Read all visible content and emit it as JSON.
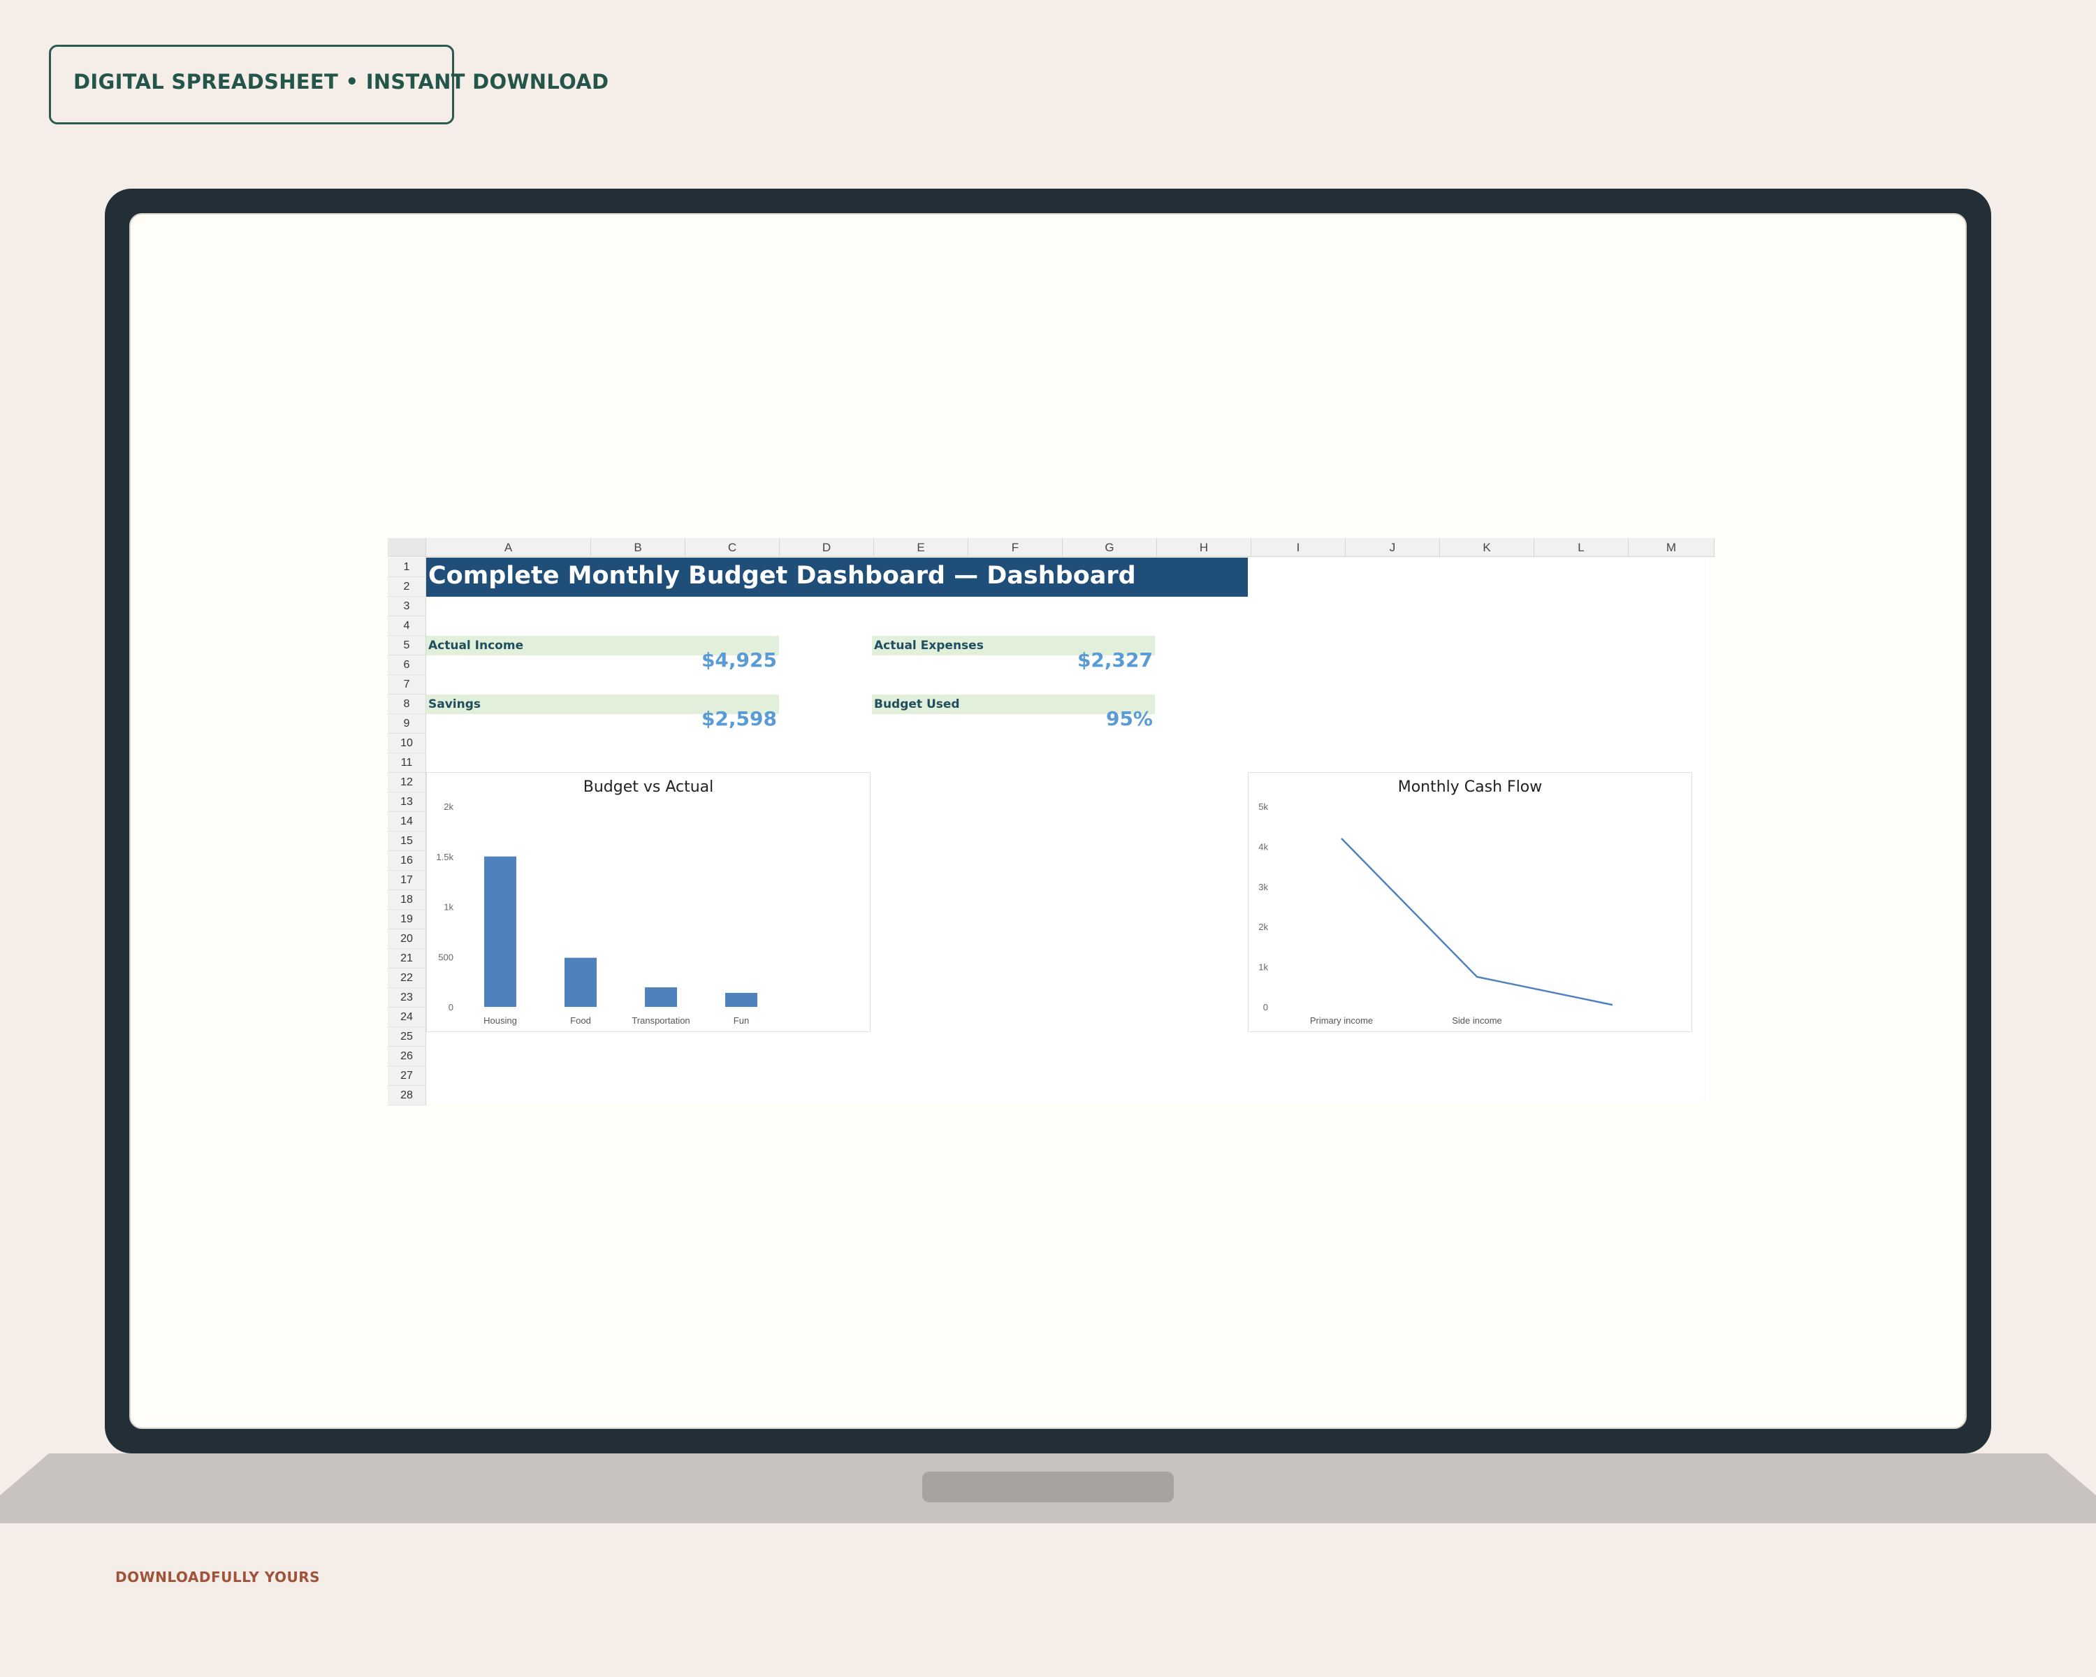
{
  "badge": {
    "text": "DIGITAL SPREADSHEET • INSTANT DOWNLOAD"
  },
  "footer": {
    "brand": "DOWNLOADFULLY YOURS"
  },
  "sheet": {
    "columns": [
      "A",
      "B",
      "C",
      "D",
      "E",
      "F",
      "G",
      "H",
      "I",
      "J",
      "K",
      "L",
      "M"
    ],
    "rows": [
      "1",
      "2",
      "3",
      "4",
      "5",
      "6",
      "7",
      "8",
      "9",
      "10",
      "11",
      "12",
      "13",
      "14",
      "15",
      "16",
      "17",
      "18",
      "19",
      "20",
      "21",
      "22",
      "23",
      "24",
      "25",
      "26",
      "27",
      "28"
    ],
    "title": "Complete Monthly Budget Dashboard — Dashboard",
    "kpis": {
      "actual_income": {
        "label": "Actual Income",
        "value": "$4,925"
      },
      "actual_expenses": {
        "label": "Actual Expenses",
        "value": "$2,327"
      },
      "savings": {
        "label": "Savings",
        "value": "$2,598"
      },
      "budget_used": {
        "label": "Budget Used",
        "value": "95%"
      }
    }
  },
  "colors": {
    "accent": "#1f4e79",
    "kpi_value": "#5b9bd5",
    "bar": "#4f81bd",
    "label_bg": "#e2efda"
  },
  "chart_data": [
    {
      "type": "bar",
      "title": "Budget vs Actual",
      "categories": [
        "Housing",
        "Food",
        "Transportation",
        "Fun"
      ],
      "values": [
        1500,
        490,
        195,
        140
      ],
      "yticks": [
        "0",
        "500",
        "1k",
        "1.5k",
        "2k"
      ],
      "ylim": [
        0,
        2000
      ],
      "grid": false
    },
    {
      "type": "line",
      "title": "Monthly Cash Flow",
      "categories": [
        "Primary income",
        "Side income",
        ""
      ],
      "values": [
        4200,
        750,
        50
      ],
      "yticks": [
        "0",
        "1k",
        "2k",
        "3k",
        "4k",
        "5k"
      ],
      "ylim": [
        0,
        5000
      ],
      "grid": false
    }
  ]
}
